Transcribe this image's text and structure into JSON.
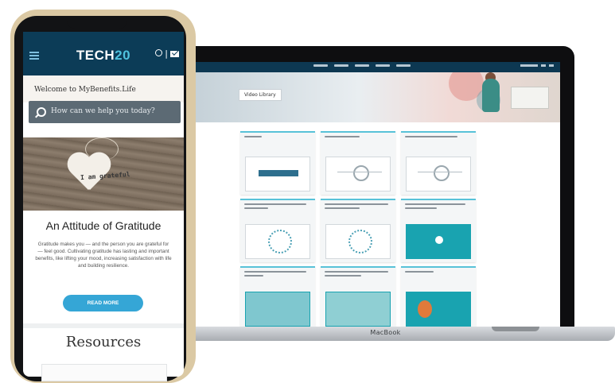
{
  "phone": {
    "brand_prefix": "TECH",
    "brand_suffix": "20",
    "header_separator": "|",
    "welcome_text": "Welcome to MyBenefits.Life",
    "search_placeholder": "How can we help you today?",
    "image_caption": "I am grateful",
    "article_title": "An Attitude of Gratitude",
    "article_body": "Gratitude makes you — and the person you are grateful for — feel good. Cultivating gratitude has lasting and important benefits, like lifting your mood, increasing satisfaction with life and building resilience.",
    "read_more_label": "READ MORE",
    "resources_heading": "Resources",
    "colors": {
      "header": "#0c3c57",
      "accent": "#4fc2de",
      "button": "#35a6d6"
    }
  },
  "laptop": {
    "brand": "MacBook",
    "video_library_label": "Video Library",
    "nav_links_count_hint": "",
    "cards": [
      {
        "title": "",
        "thumb": "logo"
      },
      {
        "title": "",
        "thumb": "diagram"
      },
      {
        "title": "",
        "thumb": "diagram"
      },
      {
        "title": "",
        "thumb": "ring"
      },
      {
        "title": "",
        "thumb": "ring"
      },
      {
        "title": "",
        "thumb": "teal-play"
      },
      {
        "title": "",
        "thumb": "teal"
      },
      {
        "title": "",
        "thumb": "teal"
      },
      {
        "title": "",
        "thumb": "teal-person"
      }
    ]
  }
}
